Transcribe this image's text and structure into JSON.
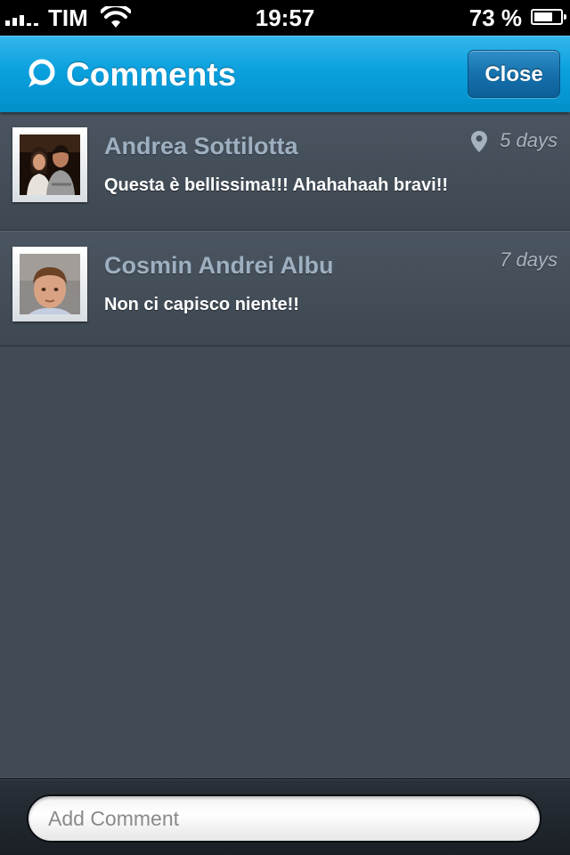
{
  "status_bar": {
    "carrier": "TIM",
    "time": "19:57",
    "battery_percent": "73 %",
    "battery_level": 0.73,
    "signal_bars": 3,
    "signal_icon": "signal-bars-icon",
    "wifi_icon": "wifi-icon",
    "battery_icon": "battery-icon"
  },
  "nav": {
    "title": "Comments",
    "title_icon": "speech-bubble-icon",
    "close_label": "Close",
    "bar_color": "#0aa0de"
  },
  "comments": [
    {
      "author": "Andrea Sottilotta",
      "age": "5 days",
      "text": "Questa è bellissima!!! Ahahahaah bravi!!",
      "has_location": true,
      "location_icon": "location-pin-icon"
    },
    {
      "author": "Cosmin Andrei Albu",
      "age": "7 days",
      "text": "Non ci capisco niente!!",
      "has_location": false
    }
  ],
  "composer": {
    "placeholder": "Add Comment",
    "value": ""
  },
  "colors": {
    "author_name": "#9eafc0",
    "background": "#414b55"
  }
}
